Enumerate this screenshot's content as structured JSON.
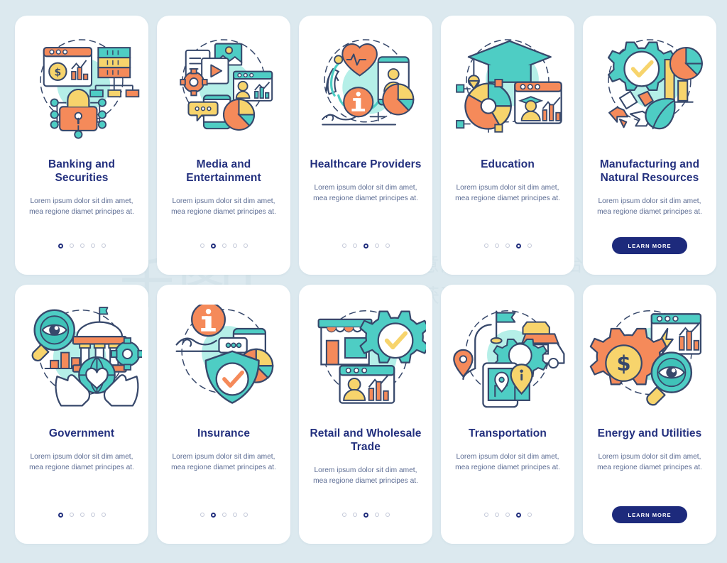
{
  "background_color": "#dce9ef",
  "palette": {
    "title": "#23307e",
    "body": "#5c6c93",
    "button_bg": "#1d2a7c",
    "button_text": "#ffffff",
    "card_bg": "#ffffff",
    "teal": "#4ecdc4",
    "orange": "#f58a5a",
    "yellow": "#f7d46c",
    "mint": "#a8ece4",
    "outline": "#37486b"
  },
  "watermark": {
    "glyph": "千图",
    "line1": "营销创意服务与协作平台",
    "line2": "商用请获取授权"
  },
  "body_text": "Lorem ipsum dolor sit dim amet, mea regione diamet principes at.",
  "learn_more_label": "LEARN MORE",
  "dot_count": 5,
  "cards": [
    {
      "title": "Banking and Securities",
      "desc": "Lorem ipsum dolor sit dim amet, mea regione diamet principes at.",
      "footer": "dots",
      "active_dot": 0,
      "illo": "banking"
    },
    {
      "title": "Media and Entertainment",
      "desc": "Lorem ipsum dolor sit dim amet, mea regione diamet principes at.",
      "footer": "dots",
      "active_dot": 1,
      "illo": "media"
    },
    {
      "title": "Healthcare Providers",
      "desc": "Lorem ipsum dolor sit dim amet, mea regione diamet principes at.",
      "footer": "dots",
      "active_dot": 2,
      "illo": "healthcare"
    },
    {
      "title": "Education",
      "desc": "Lorem ipsum dolor sit dim amet, mea regione diamet principes at.",
      "footer": "dots",
      "active_dot": 3,
      "illo": "education"
    },
    {
      "title": "Manufacturing and Natural Resources",
      "desc": "Lorem ipsum dolor sit dim amet, mea regione diamet principes at.",
      "footer": "button",
      "active_dot": -1,
      "illo": "manufacturing",
      "button_label": "LEARN MORE"
    },
    {
      "title": "Government",
      "desc": "Lorem ipsum dolor sit dim amet, mea regione diamet principes at.",
      "footer": "dots",
      "active_dot": 0,
      "illo": "government"
    },
    {
      "title": "Insurance",
      "desc": "Lorem ipsum dolor sit dim amet, mea regione diamet principes at.",
      "footer": "dots",
      "active_dot": 1,
      "illo": "insurance"
    },
    {
      "title": "Retail and Wholesale Trade",
      "desc": "Lorem ipsum dolor sit dim amet, mea regione diamet principes at.",
      "footer": "dots",
      "active_dot": 2,
      "illo": "retail"
    },
    {
      "title": "Transportation",
      "desc": "Lorem ipsum dolor sit dim amet, mea regione diamet principes at.",
      "footer": "dots",
      "active_dot": 3,
      "illo": "transportation"
    },
    {
      "title": "Energy and Utilities",
      "desc": "Lorem ipsum dolor sit dim amet, mea regione diamet principes at.",
      "footer": "button",
      "active_dot": -1,
      "illo": "energy",
      "button_label": "LEARN MORE"
    }
  ]
}
